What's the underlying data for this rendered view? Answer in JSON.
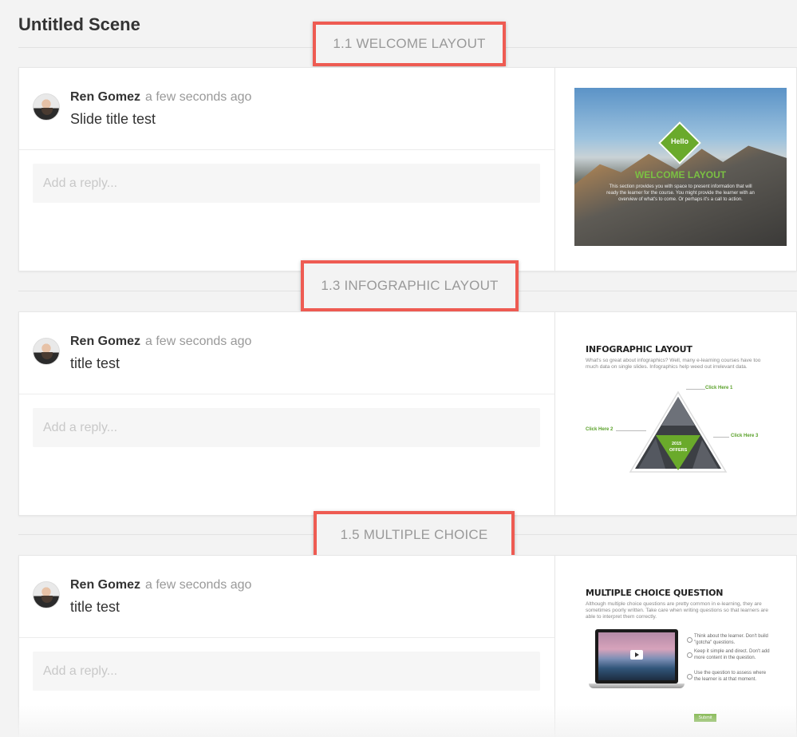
{
  "scene": {
    "title": "Untitled Scene"
  },
  "sections": [
    {
      "label": "1.1 WELCOME LAYOUT",
      "comment": {
        "author": "Ren Gomez",
        "time": "a few seconds ago",
        "text": "Slide title test"
      },
      "reply_placeholder": "Add a reply...",
      "thumbnail": {
        "badge": "Hello",
        "title": "WELCOME LAYOUT",
        "description": "This section provides you with space to present information that will ready the learner for the course. You might provide the learner with an overview of what's to come. Or perhaps it's a call to action."
      }
    },
    {
      "label": "1.3 INFOGRAPHIC LAYOUT",
      "comment": {
        "author": "Ren Gomez",
        "time": "a few seconds ago",
        "text": "title test"
      },
      "reply_placeholder": "Add a reply...",
      "thumbnail": {
        "title": "INFOGRAPHIC LAYOUT",
        "description": "What's so great about infographics? Well, many e-learning courses have too much data on single slides. Infographics help weed out irrelevant data.",
        "click1": "Click Here 1",
        "click2": "Click Here 2",
        "click3": "Click Here 3",
        "center_line1": "2015",
        "center_line2": "OFFERS"
      }
    },
    {
      "label": "1.5 MULTIPLE CHOICE",
      "comment": {
        "author": "Ren Gomez",
        "time": "a few seconds ago",
        "text": "title test"
      },
      "reply_placeholder": "Add a reply...",
      "thumbnail": {
        "title": "MULTIPLE CHOICE QUESTION",
        "description": "Although multiple choice questions are pretty common in e-learning, they are sometimes poorly written. Take care when writing questions so that learners are able to interpret them correctly.",
        "option1": "Think about the learner. Don't build \"gotcha\" questions.",
        "option2": "Keep it simple and direct. Don't add more content in the question.",
        "option3": "Use the question to assess where the learner is at that moment.",
        "submit": "Submit"
      }
    }
  ],
  "colors": {
    "highlight_border": "#ee5b52",
    "accent_green": "#6aaa2b"
  }
}
